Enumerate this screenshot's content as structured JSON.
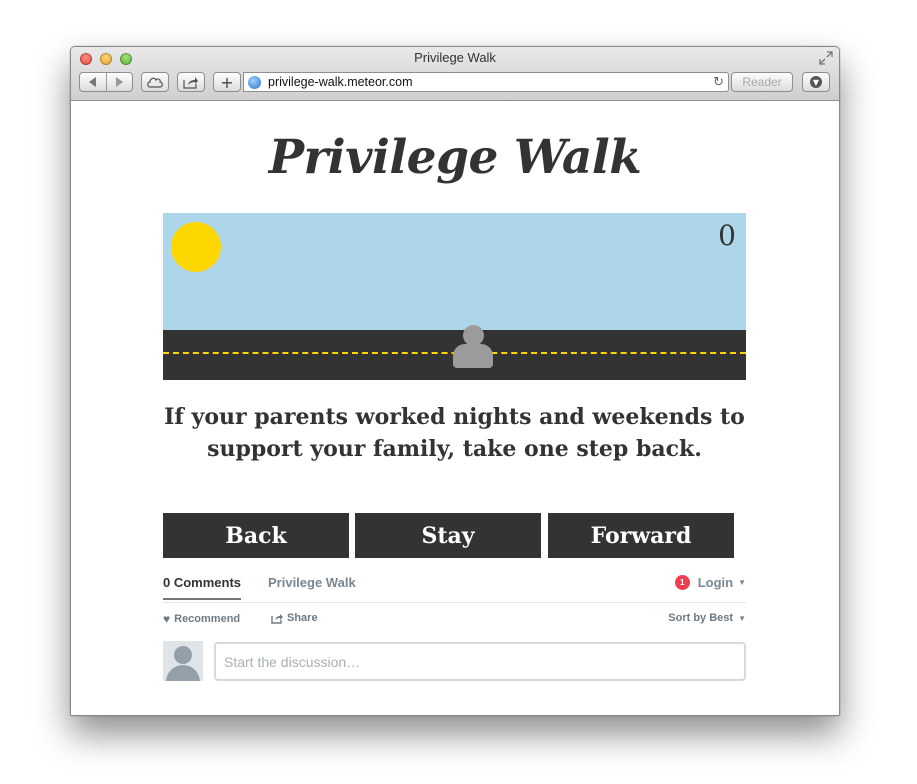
{
  "window": {
    "title": "Privilege Walk",
    "url": "privilege-walk.meteor.com",
    "reader_label": "Reader",
    "add_label": "+"
  },
  "page": {
    "site_title": "Privilege Walk",
    "step_count": "0",
    "question": "If your parents worked nights and weekends to support your family, take one step back.",
    "buttons": {
      "back": "Back",
      "stay": "Stay",
      "forward": "Forward"
    }
  },
  "comments": {
    "tab_comments": "0 Comments",
    "tab_site": "Privilege Walk",
    "notification_count": "1",
    "login_label": "Login",
    "recommend_label": "Recommend",
    "share_label": "Share",
    "sort_label": "Sort by Best",
    "input_placeholder": "Start the discussion…"
  },
  "icons": {
    "back": "back-arrow-icon",
    "forward": "forward-arrow-icon",
    "cloud": "cloud-icon",
    "share": "share-icon",
    "globe": "globe-icon",
    "reload": "reload-icon",
    "download": "download-icon",
    "fullscreen": "fullscreen-icon",
    "heart": "heart-icon"
  },
  "colors": {
    "sky": "#aed6ea",
    "sun": "#ffd700",
    "road": "#333333",
    "road_line": "#ffd700",
    "button_bg": "#333333",
    "badge": "#f03e4f"
  }
}
